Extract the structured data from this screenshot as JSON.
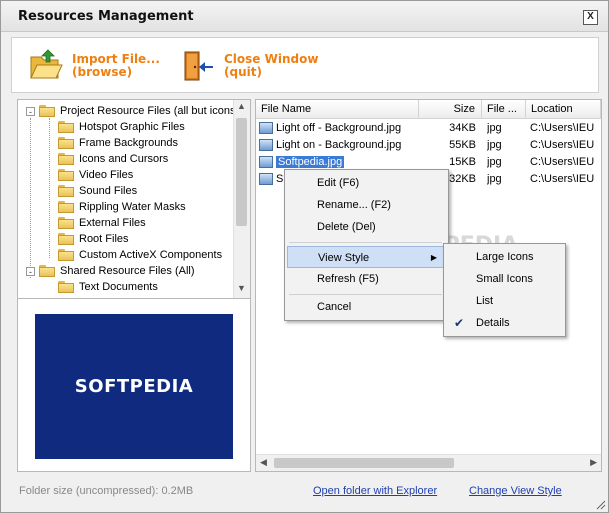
{
  "window": {
    "title": "Resources Management",
    "close_glyph": "X"
  },
  "toolbar": {
    "import_line1": "Import File...",
    "import_line2": "(browse)",
    "close_line1": "Close Window",
    "close_line2": "(quit)"
  },
  "tree": {
    "items": [
      {
        "label": "Project Resource Files (all but icons)",
        "level": 0,
        "expander": "-"
      },
      {
        "label": "Hotspot Graphic Files",
        "level": 1
      },
      {
        "label": "Frame Backgrounds",
        "level": 1
      },
      {
        "label": "Icons and Cursors",
        "level": 1
      },
      {
        "label": "Video Files",
        "level": 1
      },
      {
        "label": "Sound Files",
        "level": 1
      },
      {
        "label": "Rippling Water Masks",
        "level": 1
      },
      {
        "label": "External Files",
        "level": 1
      },
      {
        "label": "Root Files",
        "level": 1
      },
      {
        "label": "Custom ActiveX Components",
        "level": 1
      },
      {
        "label": "Shared Resource Files (All)",
        "level": 0,
        "expander": "-"
      },
      {
        "label": "Text Documents",
        "level": 1
      }
    ]
  },
  "preview": {
    "text": "SOFTPEDIA"
  },
  "list": {
    "columns": [
      "File Name",
      "Size",
      "File ...",
      "Location"
    ],
    "rows": [
      {
        "name": "Light off - Background.jpg",
        "size": "34KB",
        "type": "jpg",
        "location": "C:\\Users\\IEU"
      },
      {
        "name": "Light on - Background.jpg",
        "size": "55KB",
        "type": "jpg",
        "location": "C:\\Users\\IEU"
      },
      {
        "name": "Softpedia.jpg",
        "size": "15KB",
        "type": "jpg",
        "location": "C:\\Users\\IEU"
      },
      {
        "name": "S",
        "size": "32KB",
        "type": "jpg",
        "location": "C:\\Users\\IEU"
      }
    ]
  },
  "context_menu": {
    "edit": "Edit  (F6)",
    "rename": "Rename... (F2)",
    "delete": "Delete  (Del)",
    "view_style": "View Style",
    "refresh": "Refresh  (F5)",
    "cancel": "Cancel"
  },
  "submenu": {
    "large_icons": "Large Icons",
    "small_icons": "Small Icons",
    "list": "List",
    "details": "Details",
    "check_glyph": "✔"
  },
  "footer": {
    "folder_size": "Folder size (uncompressed): 0.2MB",
    "open_folder": "Open folder with Explorer",
    "change_view": "Change View Style"
  }
}
